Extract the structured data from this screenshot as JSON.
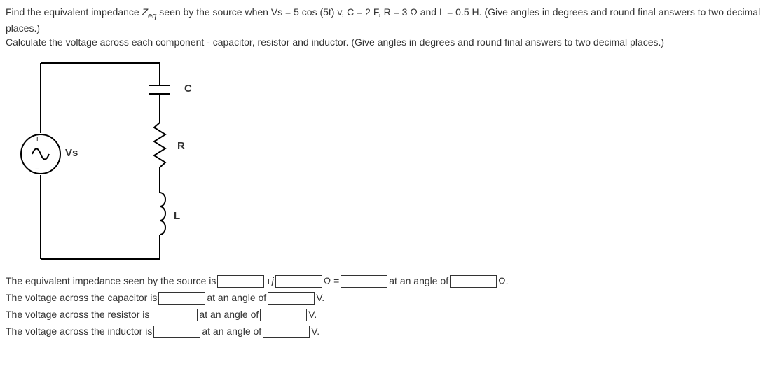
{
  "question": {
    "line1_part1": "Find the equivalent impedance ",
    "z_label": "Z",
    "z_sub": "eq",
    "line1_part2": " seen by the source when Vs = 5 cos (5t) v, C = 2 F, R = 3 Ω and L = 0.5 H. (Give angles in degrees and round final answers to two decimal places.)",
    "line2": "Calculate the voltage across each component - capacitor, resistor and inductor. (Give angles in degrees and round final answers to two decimal places.)"
  },
  "circuit": {
    "vs_label": "Vs",
    "c_label": "C",
    "r_label": "R",
    "l_label": "L"
  },
  "answers": {
    "line1_part1": "The equivalent impedance seen by the source is ",
    "plus_j": " + ",
    "j_label": "j",
    "omega_eq": " Ω = ",
    "at_angle": " at an angle of ",
    "omega_end": " Ω.",
    "line2_part1": "The voltage across the capacitor is ",
    "v_end": " V.",
    "line3_part1": "The voltage across the resistor is ",
    "line4_part1": "The voltage across the inductor is "
  }
}
